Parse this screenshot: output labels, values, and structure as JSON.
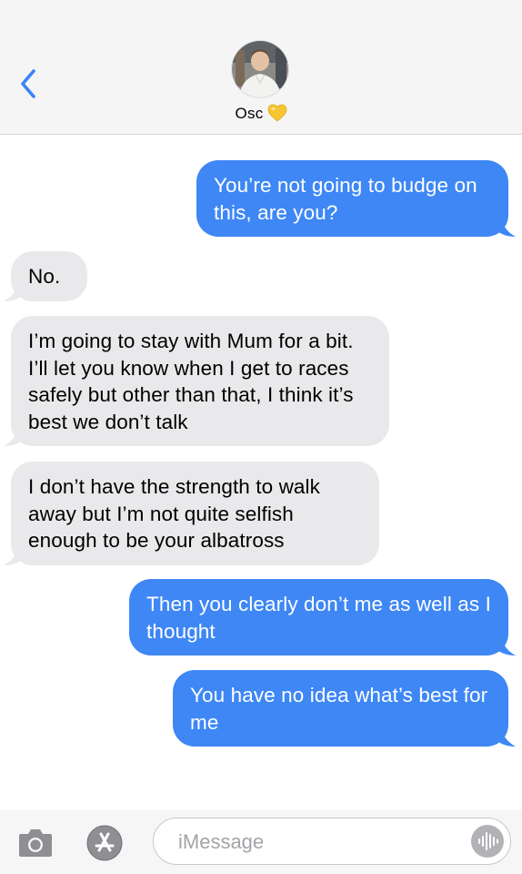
{
  "header": {
    "contact_name": "Osc",
    "contact_emoji_icon": "yellow-heart-icon",
    "back_icon": "chevron-left-icon"
  },
  "messages": [
    {
      "direction": "sent",
      "text": "You’re not going to budge on this, are you?"
    },
    {
      "direction": "received",
      "text": "No."
    },
    {
      "direction": "received",
      "text": "I’m going to stay with Mum for a bit. I’ll let you know when I get to races safely but other than that, I think it’s best we don’t talk"
    },
    {
      "direction": "received",
      "text": "I don’t have the strength to walk away but I’m not quite selfish enough to be your albatross"
    },
    {
      "direction": "sent",
      "text": "Then you clearly don’t me as well as I thought"
    },
    {
      "direction": "sent",
      "text": "You have no idea what’s best for me"
    }
  ],
  "input": {
    "placeholder": "iMessage",
    "camera_icon": "camera-icon",
    "apps_icon": "app-store-icon",
    "audio_icon": "waveform-icon"
  },
  "colors": {
    "accent": "#3e87f5",
    "received_bubble": "#e9e9eb",
    "header_bg": "#f5f5f5",
    "back_chevron": "#3b82f6"
  }
}
